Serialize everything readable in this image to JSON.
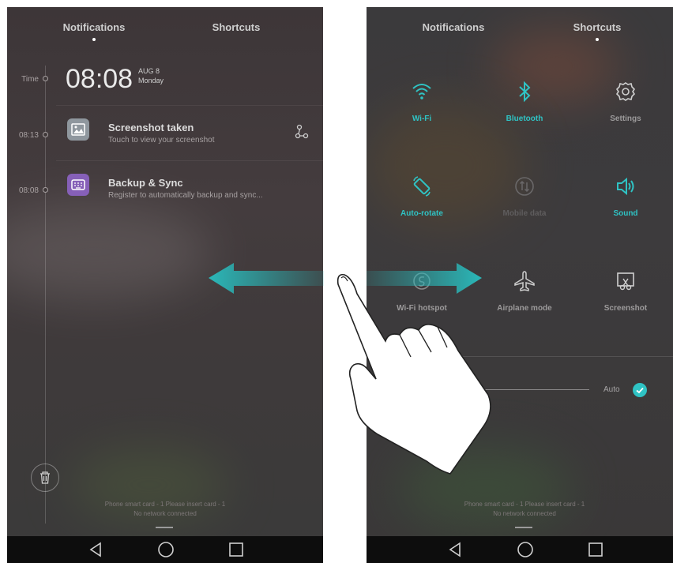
{
  "left_panel": {
    "tabs": [
      {
        "label": "Notifications",
        "active": true
      },
      {
        "label": "Shortcuts",
        "active": false
      }
    ],
    "timeline": {
      "time_label": "Time",
      "clock": "08:08",
      "date_line1": "AUG 8",
      "date_line2": "Monday"
    },
    "notifications": [
      {
        "time": "08:13",
        "title": "Screenshot taken",
        "subtitle": "Touch to view your screenshot",
        "icon": "gallery-icon",
        "action_icon": "share-icon"
      },
      {
        "time": "08:08",
        "title": "Backup & Sync",
        "subtitle": "Register to automatically backup and sync...",
        "icon": "keyboard-icon"
      }
    ],
    "footer_line1": "Phone smart card - 1 Please insert card - 1",
    "footer_line2": "No network connected"
  },
  "right_panel": {
    "tabs": [
      {
        "label": "Notifications",
        "active": false
      },
      {
        "label": "Shortcuts",
        "active": true
      }
    ],
    "shortcuts": [
      {
        "label": "Wi-Fi",
        "icon": "wifi-icon",
        "state": "on"
      },
      {
        "label": "Bluetooth",
        "icon": "bluetooth-icon",
        "state": "on"
      },
      {
        "label": "Settings",
        "icon": "gear-icon",
        "state": "neutral"
      },
      {
        "label": "Auto-rotate",
        "icon": "auto-rotate-icon",
        "state": "on"
      },
      {
        "label": "Mobile data",
        "icon": "mobile-data-icon",
        "state": "disabled"
      },
      {
        "label": "Sound",
        "icon": "speaker-icon",
        "state": "on"
      },
      {
        "label": "Wi-Fi hotspot",
        "icon": "hotspot-icon",
        "state": "neutral"
      },
      {
        "label": "Airplane mode",
        "icon": "airplane-icon",
        "state": "neutral"
      },
      {
        "label": "Screenshot",
        "icon": "screenshot-icon",
        "state": "neutral"
      }
    ],
    "brightness": {
      "level": 0.35,
      "auto_label": "Auto",
      "auto_checked": true
    },
    "footer_line1": "Phone smart card - 1 Please insert card - 1",
    "footer_line2": "No network connected"
  },
  "navbar": {
    "icons": [
      "back-icon",
      "home-icon",
      "recents-icon"
    ]
  },
  "overlay": {
    "gesture": "swipe-left-right",
    "arrow_color": "#2ab7b8",
    "hand_icon": "pointing-hand-icon"
  },
  "colors": {
    "accent": "#2fc3c4"
  }
}
